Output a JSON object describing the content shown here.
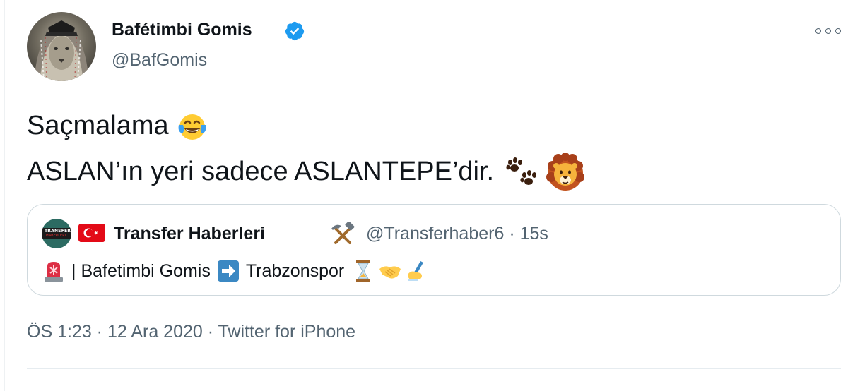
{
  "author": {
    "name": "Bafétimbi Gomis",
    "handle": "@BafGomis",
    "verified": true
  },
  "tweet": {
    "line1": "Saçmalama",
    "line2": "ASLAN’ın yeri sadece ASLANTEPE’dir.",
    "line1_emoji": "face-with-tears-of-joy-icon",
    "line2_emojis": [
      "paw-prints-icon",
      "lion-face-icon"
    ]
  },
  "quoted_tweet": {
    "name": "Transfer Haberleri",
    "handle_time": "@Transferhaber6 · 15s",
    "text_part1": "| Bafetimbi Gomis",
    "text_part2": "Trabzonspor",
    "icons": [
      "police-light-icon",
      "right-arrow-icon",
      "hourglass-icon",
      "handshake-icon",
      "writing-hand-icon"
    ],
    "avatar_text": "TRANSFER HABERLERI"
  },
  "meta": {
    "timestamp": "ÖS 1:23 · 12 Ara 2020 · Twitter for iPhone"
  },
  "colors": {
    "text": "#0f1419",
    "secondary": "#536471",
    "verified": "#1d9bf0",
    "border": "#cfd9de"
  }
}
